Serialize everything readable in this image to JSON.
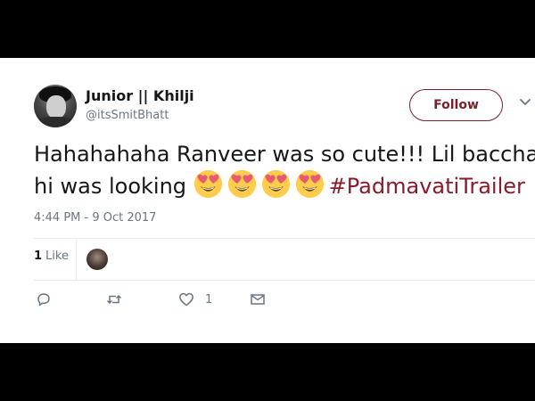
{
  "tweet": {
    "author_name": "Junior || Khilji",
    "author_handle": "@itsSmitBhatt",
    "follow_label": "Follow",
    "text_line1": "Hahahahaha Ranveer was so cute!!! Lil baccha",
    "text_line2_prefix": "hi was looking",
    "emoji_name": "smiling-face-with-heart-eyes",
    "emoji_count": 4,
    "hashtag": "#PadmavatiTrailer",
    "timestamp": "4:44 PM - 9 Oct 2017",
    "like_count": "1",
    "like_label": "Like",
    "actions": {
      "reply_count": "",
      "retweet_count": "",
      "like_count": "1",
      "dm_count": ""
    }
  },
  "colors": {
    "accent": "#7a1f2b",
    "hashtag": "#8b1a2b",
    "secondary_text": "#657786",
    "primary_text": "#14171a"
  },
  "icons": [
    "caret-down-icon",
    "reply-icon",
    "retweet-icon",
    "heart-icon",
    "envelope-icon"
  ]
}
